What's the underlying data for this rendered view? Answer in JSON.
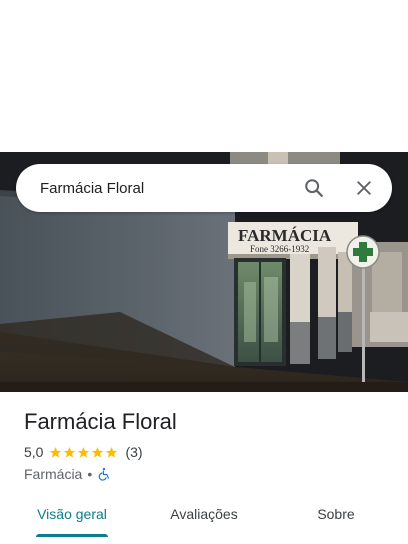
{
  "search": {
    "value": "Farmácia Floral",
    "search_icon": "search-icon",
    "close_icon": "close-icon"
  },
  "photo": {
    "sign_text": "FARMÁCIA",
    "sign_phone": "Fone 3266-1932",
    "round_sign_text": "FARMÁCIA"
  },
  "place": {
    "name": "Farmácia Floral",
    "rating": "5,0",
    "stars": 5,
    "review_count": "(3)",
    "category": "Farmácia",
    "separator": "•",
    "accessibility_icon": "wheelchair-icon"
  },
  "tabs": [
    {
      "label": "Visão geral",
      "active": true
    },
    {
      "label": "Avaliações",
      "active": false
    },
    {
      "label": "Sobre",
      "active": false
    }
  ],
  "colors": {
    "accent": "#0b7d8c",
    "star": "#fbbc04",
    "accessibility": "#1a73e8"
  }
}
